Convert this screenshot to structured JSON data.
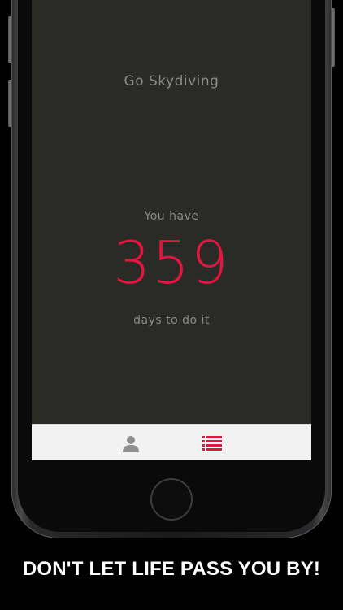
{
  "goal": {
    "title": "Go Skydiving"
  },
  "countdown": {
    "prefix": "You have",
    "days": "359",
    "suffix": "days to do it"
  },
  "tabbar": {
    "tabs": [
      {
        "icon": "person-icon",
        "active": false
      },
      {
        "icon": "list-icon",
        "active": true
      }
    ]
  },
  "tagline": "DON'T LET LIFE PASS YOU BY!",
  "colors": {
    "accent": "#e3163f",
    "screen_bg": "#2a2a26",
    "muted_text": "#8a8a86",
    "tabbar_bg": "#f2f2f2",
    "inactive_icon": "#8e8e8e"
  }
}
